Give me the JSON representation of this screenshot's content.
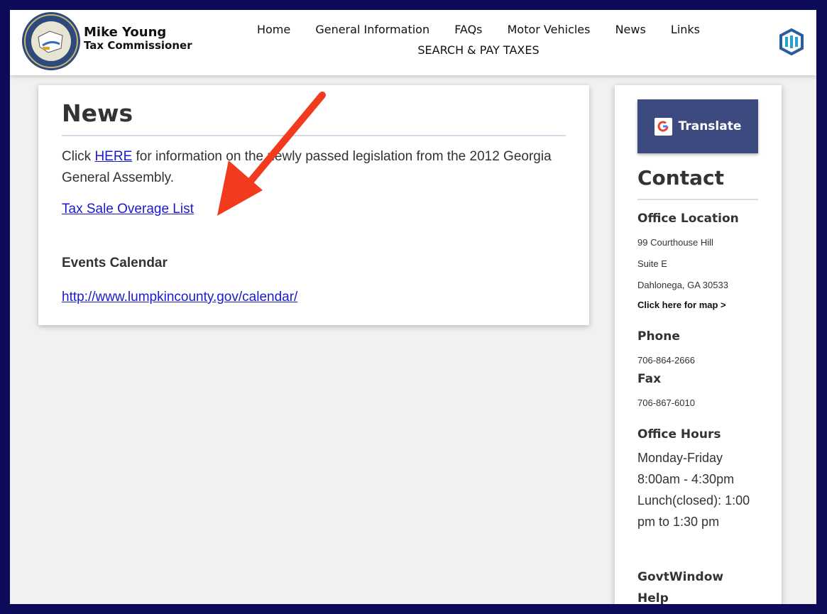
{
  "brand": {
    "name": "Mike Young",
    "subtitle": "Tax Commissioner",
    "seal_icon": "lumpkin-county-seal-icon"
  },
  "nav": {
    "items": [
      "Home",
      "General Information",
      "FAQs",
      "Motor Vehicles",
      "News",
      "Links"
    ],
    "search_pay": "SEARCH & PAY TAXES",
    "logo_icon": "govtwindow-logo-icon"
  },
  "news": {
    "title": "News",
    "para_prefix": "Click ",
    "here_link": "HERE",
    "para_suffix": " for information on the newly passed legislation from the 2012 Georgia General Assembly.",
    "tax_sale_link": "Tax Sale Overage List",
    "events_heading": "Events Calendar",
    "calendar_link": "http://www.lumpkincounty.gov/calendar/"
  },
  "sidebar": {
    "translate_label": "Translate",
    "contact_title": "Contact",
    "office_location_heading": "Office Location",
    "address_line1": "99 Courthouse Hill",
    "address_line2": "Suite E",
    "address_line3": "Dahlonega, GA 30533",
    "map_link": "Click here for map >",
    "phone_heading": "Phone",
    "phone": "706-864-2666",
    "fax_heading": "Fax",
    "fax": "706-867-6010",
    "hours_heading": "Office Hours",
    "hours_text": "Monday-Friday 8:00am - 4:30pm Lunch(closed): 1:00 pm to 1:30 pm",
    "govtwindow_heading": "GovtWindow Help"
  },
  "colors": {
    "frame": "#0b0b5a",
    "link": "#1a1acc",
    "translate_bg": "#3c4a80",
    "annotation_arrow": "#f23a1e"
  }
}
